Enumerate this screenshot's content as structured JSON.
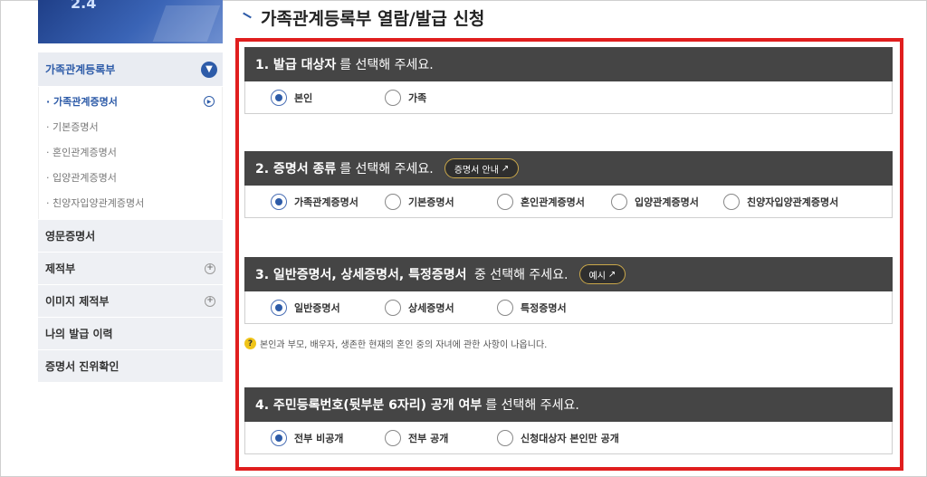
{
  "banner": {
    "text": "2.4"
  },
  "sidebar": {
    "head": "가족관계등록부",
    "sub_items": [
      {
        "label": "· 가족관계증명서",
        "active": true
      },
      {
        "label": "· 기본증명서",
        "active": false
      },
      {
        "label": "· 혼인관계증명서",
        "active": false
      },
      {
        "label": "· 입양관계증명서",
        "active": false
      },
      {
        "label": "· 친양자입양관계증명서",
        "active": false
      }
    ],
    "items": [
      {
        "label": "영문증명서",
        "plus": false
      },
      {
        "label": "제적부",
        "plus": true
      },
      {
        "label": "이미지 제적부",
        "plus": true
      },
      {
        "label": "나의 발급 이력",
        "plus": false
      },
      {
        "label": "증명서 진위확인",
        "plus": false
      }
    ]
  },
  "page_title": "가족관계등록부 열람/발급 신청",
  "sections": [
    {
      "bold": "1. 발급 대상자",
      "rest": "를 선택해 주세요.",
      "button": "",
      "options": [
        {
          "label": "본인",
          "checked": true
        },
        {
          "label": "가족",
          "checked": false
        }
      ]
    },
    {
      "bold": "2. 증명서 종류",
      "rest": "를 선택해 주세요.",
      "button": "증명서 안내",
      "options": [
        {
          "label": "가족관계증명서",
          "checked": true
        },
        {
          "label": "기본증명서",
          "checked": false
        },
        {
          "label": "혼인관계증명서",
          "checked": false
        },
        {
          "label": "입양관계증명서",
          "checked": false
        },
        {
          "label": "친양자입양관계증명서",
          "checked": false
        }
      ]
    },
    {
      "bold": "3. 일반증명서, 상세증명서, 특정증명서",
      "rest": " 중 선택해 주세요.",
      "button": "예시",
      "options": [
        {
          "label": "일반증명서",
          "checked": true
        },
        {
          "label": "상세증명서",
          "checked": false
        },
        {
          "label": "특정증명서",
          "checked": false
        }
      ]
    },
    {
      "bold": "4. 주민등록번호(뒷부분 6자리) 공개 여부",
      "rest": "를 선택해 주세요.",
      "button": "",
      "options": [
        {
          "label": "전부 비공개",
          "checked": true
        },
        {
          "label": "전부 공개",
          "checked": false
        },
        {
          "label": "신청대상자 본인만 공개",
          "checked": false
        }
      ]
    }
  ],
  "hint": "본인과 부모, 배우자, 생존한 현재의 혼인 중의 자녀에 관한 사항이 나옵니다.",
  "hint_icon": "?",
  "icons": {
    "chevron": "chevron-down-icon",
    "external": "external-link-icon",
    "help": "question-icon"
  }
}
